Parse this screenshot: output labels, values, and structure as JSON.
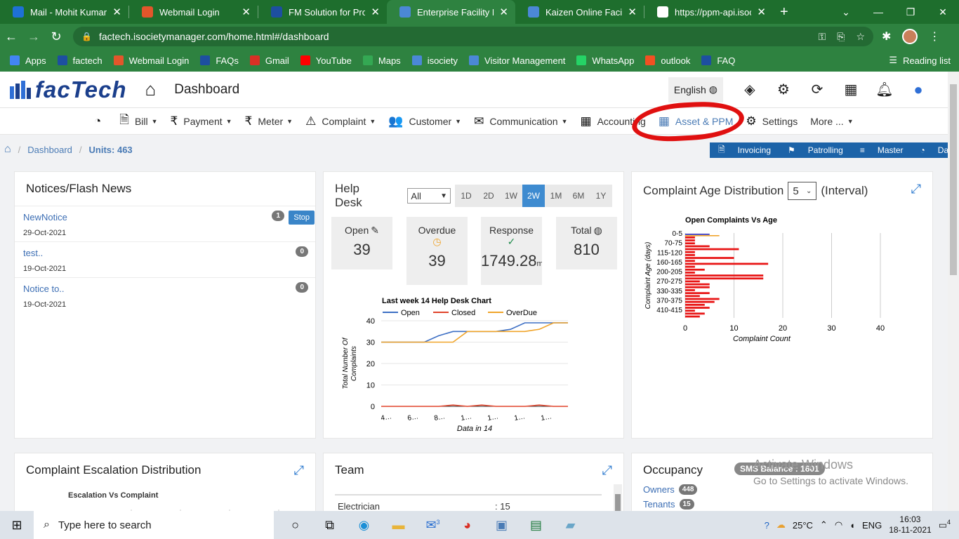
{
  "browser": {
    "tabs": [
      {
        "title": "Mail - Mohit Kumar Ja",
        "icon_color": "#1e71d6",
        "icon": "outlook-icon"
      },
      {
        "title": "Webmail Login",
        "icon_color": "#e2562b",
        "icon": "cpanel-icon"
      },
      {
        "title": "FM Solution for Prope",
        "icon_color": "#1d4fa0",
        "icon": "factech-icon"
      },
      {
        "title": "Enterprise Facility Mar",
        "icon_color": "#4b88d6",
        "icon": "isociety-icon"
      },
      {
        "title": "Kaizen Online Facility",
        "icon_color": "#4b88d6",
        "icon": "isociety-icon"
      },
      {
        "title": "https://ppm-api.isocie",
        "icon_color": "#ffffff",
        "icon": "globe-icon"
      }
    ],
    "url": "factech.isocietymanager.com/home.html#/dashboard",
    "bookmarks": [
      {
        "label": "Apps",
        "color": "#4285f4"
      },
      {
        "label": "factech",
        "color": "#1d4fa0"
      },
      {
        "label": "Webmail Login",
        "color": "#e2562b"
      },
      {
        "label": "FAQs",
        "color": "#1d4fa0"
      },
      {
        "label": "Gmail",
        "color": "#d93025"
      },
      {
        "label": "YouTube",
        "color": "#ff0000"
      },
      {
        "label": "Maps",
        "color": "#34a853"
      },
      {
        "label": "isociety",
        "color": "#4b88d6"
      },
      {
        "label": "Visitor Management",
        "color": "#4b88d6"
      },
      {
        "label": "WhatsApp",
        "color": "#25d366"
      },
      {
        "label": "outlook",
        "color": "#f25022"
      },
      {
        "label": "FAQ",
        "color": "#1d4fa0"
      }
    ],
    "reading_list": "Reading list"
  },
  "app": {
    "logo": "facTech",
    "page_title": "Dashboard",
    "language": "English",
    "menu": [
      {
        "label": "Bill",
        "icon": "bill-icon",
        "glyph": "🗎",
        "caret": true
      },
      {
        "label": "Payment",
        "icon": "rupee-icon",
        "glyph": "₹",
        "caret": true
      },
      {
        "label": "Meter",
        "icon": "rupee-icon",
        "glyph": "₹",
        "caret": true
      },
      {
        "label": "Complaint",
        "icon": "warning-icon",
        "glyph": "⚠",
        "caret": true
      },
      {
        "label": "Customer",
        "icon": "users-icon",
        "glyph": "👥",
        "caret": true
      },
      {
        "label": "Communication",
        "icon": "envelope-icon",
        "glyph": "✉",
        "caret": true
      },
      {
        "label": "Accounting",
        "icon": "calendar-icon",
        "glyph": "▦",
        "caret": false
      },
      {
        "label": "Asset & PPM",
        "icon": "calendar-icon",
        "glyph": "▦",
        "caret": false
      },
      {
        "label": "Settings",
        "icon": "gear-icon",
        "glyph": "⚙",
        "caret": false
      },
      {
        "label": "More ...",
        "icon": "",
        "glyph": "",
        "caret": true
      }
    ],
    "breadcrumb": {
      "dashboard": "Dashboard",
      "units": "Units: 463"
    },
    "quick_links": [
      {
        "label": "Invoicing",
        "glyph": "🗎"
      },
      {
        "label": "Patrolling",
        "glyph": "⚑"
      },
      {
        "label": "Master",
        "glyph": "≡"
      },
      {
        "label": "Dashboards",
        "glyph": "◔"
      }
    ]
  },
  "notices": {
    "title": "Notices/Flash News",
    "stop_label": "Stop",
    "items": [
      {
        "title": "NewNotice",
        "date": "29-Oct-2021",
        "count": "1"
      },
      {
        "title": "test..",
        "date": "19-Oct-2021",
        "count": "0"
      },
      {
        "title": "Notice to..",
        "date": "19-Oct-2021",
        "count": "0"
      }
    ]
  },
  "helpdesk": {
    "title": "Help Desk",
    "filter": "All",
    "ranges": [
      "1D",
      "2D",
      "1W",
      "2W",
      "1M",
      "6M",
      "1Y"
    ],
    "active_range": "2W",
    "stats": [
      {
        "label": "Open",
        "value": "39",
        "icon": "pencil-icon"
      },
      {
        "label": "Overdue",
        "value": "39",
        "icon": "clock-icon"
      },
      {
        "label": "Response",
        "value": "1749.28",
        "unit": "mi",
        "icon": "check-circle-icon"
      },
      {
        "label": "Total",
        "value": "810",
        "icon": "globe-icon"
      }
    ]
  },
  "complaint_age": {
    "title": "Complaint Age Distribution",
    "interval": "5",
    "interval_label": "(Interval)"
  },
  "escalation": {
    "title": "Complaint Escalation Distribution",
    "chart_title": "Escalation Vs Complaint"
  },
  "team": {
    "title": "Team",
    "rows": [
      {
        "name": "Electrician",
        "value": ": 15"
      }
    ]
  },
  "occupancy": {
    "title": "Occupancy",
    "rows": [
      {
        "label": "Owners",
        "count": "448"
      },
      {
        "label": "Tenants",
        "count": "15"
      }
    ],
    "sms": "SMS Balance : 1601"
  },
  "windows": {
    "activate_title": "Activate Windows",
    "activate_sub": "Go to Settings to activate Windows.",
    "search": "Type here to search",
    "temp": "25°C",
    "lang": "ENG",
    "time": "16:03",
    "date": "18-11-2021",
    "notif": "4",
    "mail_badge": "3"
  },
  "chart_data": [
    {
      "type": "line",
      "title": "Last week 14 Help Desk Chart",
      "xlabel": "Data in 14",
      "ylabel": "Total Number Of Complaints",
      "ylim": [
        0,
        40
      ],
      "yticks": [
        0,
        10,
        20,
        30,
        40
      ],
      "xtick_labels": [
        "4…",
        "6…",
        "8…",
        "1…",
        "1…",
        "1…",
        "1…"
      ],
      "series": [
        {
          "name": "Open",
          "color": "#3d6fc4",
          "values": [
            30,
            30,
            30,
            30,
            33,
            35,
            35,
            35,
            35,
            36,
            39,
            39,
            39,
            39
          ]
        },
        {
          "name": "Closed",
          "color": "#e0432a",
          "values": [
            0,
            0,
            0,
            0,
            0,
            0.6,
            0,
            0.6,
            0,
            0,
            0,
            0.6,
            0,
            0
          ]
        },
        {
          "name": "OverDue",
          "color": "#f0a42a",
          "values": [
            30,
            30,
            30,
            30,
            30,
            30,
            35,
            35,
            35,
            35,
            35,
            36,
            39,
            39
          ]
        }
      ]
    },
    {
      "type": "bar",
      "orientation": "horizontal",
      "title": "Open Complaints Vs Age",
      "xlabel": "Complaint Count",
      "ylabel": "Complaint Age (days)",
      "xlim": [
        0,
        40
      ],
      "xticks": [
        0,
        10,
        20,
        30,
        40
      ],
      "ytick_labels": [
        "0-5",
        "70-75",
        "115-120",
        "160-165",
        "200-205",
        "270-275",
        "330-335",
        "370-375",
        "410-415"
      ],
      "first_row": {
        "blue": 5,
        "orange": 7
      },
      "values": [
        2,
        2,
        2,
        5,
        11,
        2,
        2,
        10,
        2,
        17,
        2,
        4,
        2,
        16,
        16,
        3,
        5,
        5,
        2,
        5,
        3,
        7,
        6,
        4,
        5,
        2,
        4,
        3
      ]
    },
    {
      "type": "bar",
      "title": "Escalation Vs Complaint",
      "values": []
    }
  ]
}
